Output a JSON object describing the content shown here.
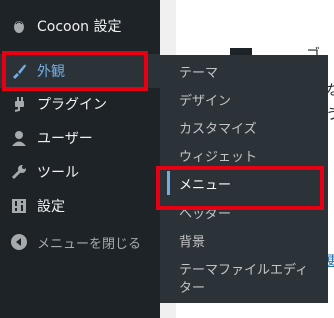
{
  "sidebar": {
    "items": [
      {
        "label": "Cocoon 設定",
        "icon": "cocoon-icon"
      },
      {
        "label": "外観",
        "icon": "appearance-brush-icon",
        "active": true
      },
      {
        "label": "プラグイン",
        "icon": "plugin-icon"
      },
      {
        "label": "ユーザー",
        "icon": "user-icon"
      },
      {
        "label": "ツール",
        "icon": "wrench-icon"
      },
      {
        "label": "設定",
        "icon": "settings-icon"
      },
      {
        "label": "メニューを閉じる",
        "icon": "collapse-arrow-icon"
      }
    ]
  },
  "submenu": {
    "items": [
      {
        "label": "テーマ"
      },
      {
        "label": "デザイン"
      },
      {
        "label": "カスタマイズ"
      },
      {
        "label": "ウィジェット"
      },
      {
        "label": "メニュー",
        "current": true
      },
      {
        "label": "ヘッダー"
      },
      {
        "label": "背景"
      },
      {
        "label": "テーマファイルエディ"
      },
      {
        "label": "ター"
      }
    ]
  },
  "content": {
    "fragments": [
      "ゴ",
      "な",
      "う"
    ],
    "link_fragment": "更"
  },
  "colors": {
    "sidebar_bg": "#1d2327",
    "submenu_bg": "#2c3338",
    "accent": "#72aee6",
    "highlight": "#e60012"
  }
}
